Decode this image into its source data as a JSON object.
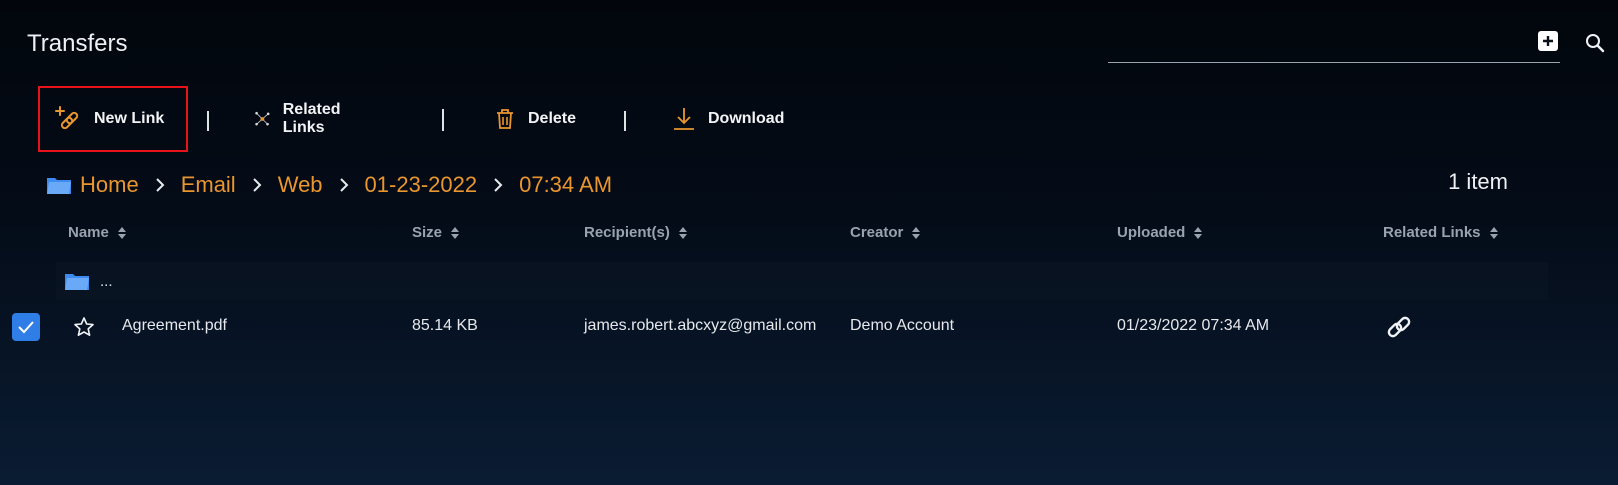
{
  "page": {
    "title": "Transfers"
  },
  "search": {
    "value": "",
    "placeholder": ""
  },
  "toolbar": {
    "new_link_label": "New Link",
    "related_links_label": "Related Links",
    "delete_label": "Delete",
    "download_label": "Download"
  },
  "breadcrumb": [
    "Home",
    "Email",
    "Web",
    "01-23-2022",
    "07:34 AM"
  ],
  "item_count": "1 item",
  "table": {
    "columns": [
      "Name",
      "Size",
      "Recipient(s)",
      "Creator",
      "Uploaded",
      "Related Links"
    ],
    "parent_label": "...",
    "rows": [
      {
        "name": "Agreement.pdf",
        "size": "85.14 KB",
        "recipients": "james.robert.abcxyz@gmail.com",
        "creator": "Demo Account",
        "uploaded": "01/23/2022 07:34 AM",
        "checked": true,
        "starred": false
      }
    ]
  },
  "colors": {
    "accent": "#e9962f",
    "checkbox": "#2f7de6",
    "highlight_border": "#e8121a",
    "folder": "#3d8bf0"
  },
  "icons": [
    "add-square-icon",
    "search-icon",
    "add-link-icon",
    "network-icon",
    "trash-icon",
    "download-icon",
    "folder-icon",
    "chevron-right-icon",
    "sort-icon",
    "checkmark-icon",
    "star-icon",
    "link-icon"
  ]
}
